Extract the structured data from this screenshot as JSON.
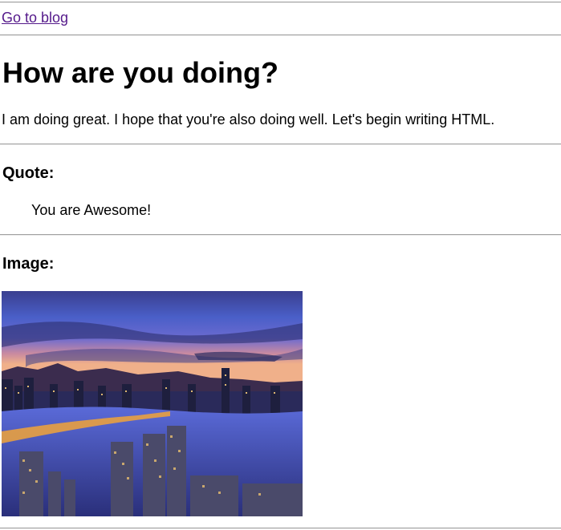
{
  "nav": {
    "blog_link": "Go to blog"
  },
  "header": {
    "title": "How are you doing?"
  },
  "intro": {
    "text": "I am doing great. I hope that you're also doing well. Let's begin writing HTML."
  },
  "quote_section": {
    "heading": "Quote:",
    "quote": "You are Awesome!"
  },
  "image_section": {
    "heading": "Image:"
  },
  "colors": {
    "link": "#551a8b",
    "rule": "#a0a0a0"
  }
}
